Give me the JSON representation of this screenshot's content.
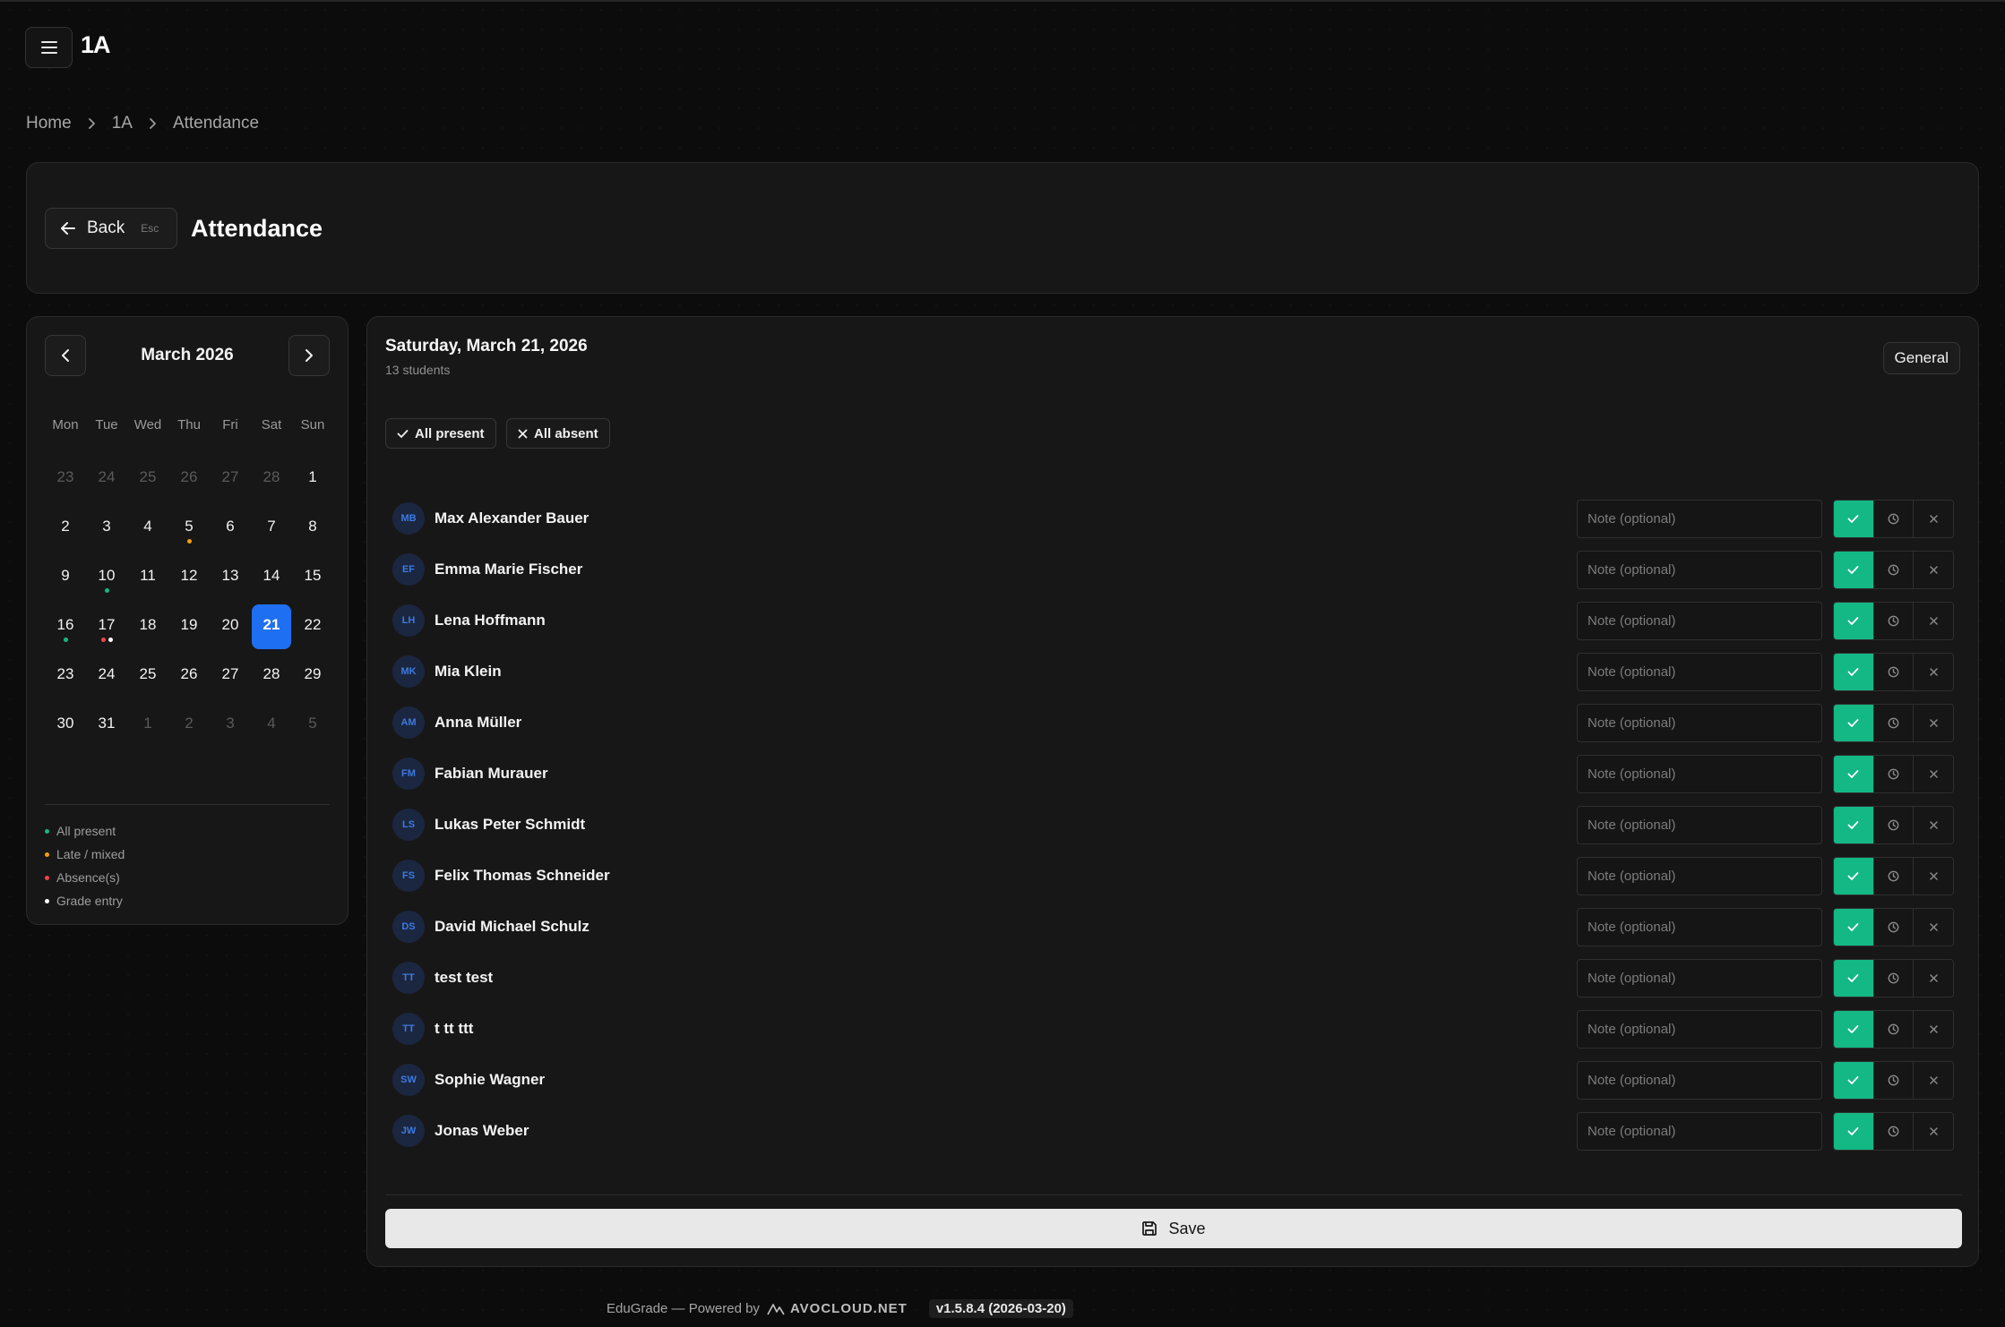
{
  "app": {
    "logo": "1A",
    "menu_icon": "hamburger-icon"
  },
  "breadcrumb": [
    {
      "label": "Home"
    },
    {
      "label": "1A"
    },
    {
      "label": "Attendance"
    }
  ],
  "header": {
    "back_label": "Back",
    "back_shortcut": "Esc",
    "title": "Attendance"
  },
  "calendar": {
    "month_label": "March 2026",
    "weekdays": [
      "Mon",
      "Tue",
      "Wed",
      "Thu",
      "Fri",
      "Sat",
      "Sun"
    ],
    "weeks": [
      [
        {
          "d": "23",
          "m": true
        },
        {
          "d": "24",
          "m": true
        },
        {
          "d": "25",
          "m": true
        },
        {
          "d": "26",
          "m": true
        },
        {
          "d": "27",
          "m": true
        },
        {
          "d": "28",
          "m": true
        },
        {
          "d": "1"
        }
      ],
      [
        {
          "d": "2"
        },
        {
          "d": "3"
        },
        {
          "d": "4"
        },
        {
          "d": "5",
          "dots": [
            "late"
          ]
        },
        {
          "d": "6"
        },
        {
          "d": "7"
        },
        {
          "d": "8"
        }
      ],
      [
        {
          "d": "9"
        },
        {
          "d": "10",
          "dots": [
            "present"
          ]
        },
        {
          "d": "11"
        },
        {
          "d": "12"
        },
        {
          "d": "13"
        },
        {
          "d": "14"
        },
        {
          "d": "15"
        }
      ],
      [
        {
          "d": "16",
          "dots": [
            "present"
          ]
        },
        {
          "d": "17",
          "dots": [
            "absence",
            "grade"
          ]
        },
        {
          "d": "18"
        },
        {
          "d": "19"
        },
        {
          "d": "20"
        },
        {
          "d": "21",
          "selected": true
        },
        {
          "d": "22"
        }
      ],
      [
        {
          "d": "23"
        },
        {
          "d": "24"
        },
        {
          "d": "25"
        },
        {
          "d": "26"
        },
        {
          "d": "27"
        },
        {
          "d": "28"
        },
        {
          "d": "29"
        }
      ],
      [
        {
          "d": "30"
        },
        {
          "d": "31"
        },
        {
          "d": "1",
          "m": true
        },
        {
          "d": "2",
          "m": true
        },
        {
          "d": "3",
          "m": true
        },
        {
          "d": "4",
          "m": true
        },
        {
          "d": "5",
          "m": true
        }
      ]
    ],
    "legend": [
      {
        "key": "present",
        "label": "All present",
        "color": "#14b885"
      },
      {
        "key": "late",
        "label": "Late / mixed",
        "color": "#f59e0b"
      },
      {
        "key": "absence",
        "label": "Absence(s)",
        "color": "#ef4444"
      },
      {
        "key": "grade",
        "label": "Grade entry",
        "color": "#ffffff"
      }
    ]
  },
  "main": {
    "date_title": "Saturday, March 21, 2026",
    "student_count": "13 students",
    "subject_label": "General",
    "all_present_label": "All present",
    "all_absent_label": "All absent",
    "note_placeholder": "Note (optional)",
    "save_label": "Save",
    "students": [
      {
        "initials": "MB",
        "name": "Max Alexander Bauer",
        "status": "present"
      },
      {
        "initials": "EF",
        "name": "Emma Marie Fischer",
        "status": "present"
      },
      {
        "initials": "LH",
        "name": "Lena Hoffmann",
        "status": "present"
      },
      {
        "initials": "MK",
        "name": "Mia Klein",
        "status": "present"
      },
      {
        "initials": "AM",
        "name": "Anna Müller",
        "status": "present"
      },
      {
        "initials": "FM",
        "name": "Fabian Murauer",
        "status": "present"
      },
      {
        "initials": "LS",
        "name": "Lukas Peter Schmidt",
        "status": "present"
      },
      {
        "initials": "FS",
        "name": "Felix Thomas Schneider",
        "status": "present"
      },
      {
        "initials": "DS",
        "name": "David Michael Schulz",
        "status": "present"
      },
      {
        "initials": "TT",
        "name": "test test",
        "status": "present"
      },
      {
        "initials": "TT",
        "name": "t tt ttt",
        "status": "present"
      },
      {
        "initials": "SW",
        "name": "Sophie Wagner",
        "status": "present"
      },
      {
        "initials": "JW",
        "name": "Jonas Weber",
        "status": "present"
      }
    ]
  },
  "footer": {
    "text": "EduGrade — Powered by",
    "brand": "AVOCLOUD.NET",
    "version": "v1.5.8.4 (2026-03-20)"
  },
  "colors": {
    "accent": "#1f6ff2",
    "present": "#14b885"
  }
}
